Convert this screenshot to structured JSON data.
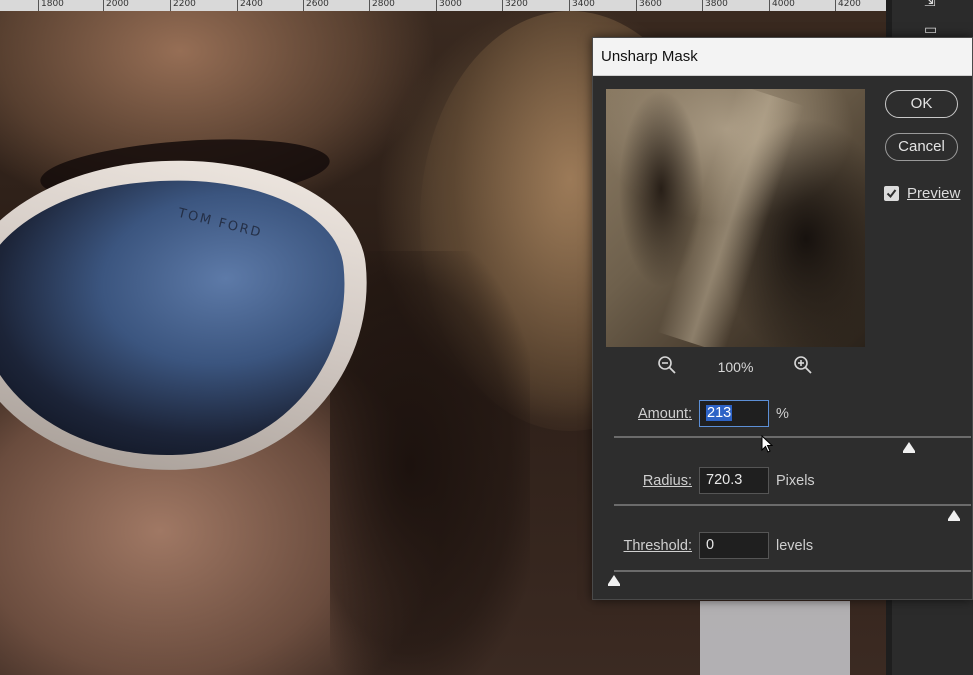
{
  "ruler": {
    "ticks": [
      "1800",
      "2000",
      "2200",
      "2400",
      "2600",
      "2800",
      "3000",
      "3200",
      "3400",
      "3600",
      "3800",
      "4000",
      "4200"
    ]
  },
  "canvas": {
    "brand_text": "TOM FORD"
  },
  "dialog": {
    "title": "Unsharp Mask",
    "zoom": {
      "percent": "100%",
      "zoom_out_icon": "zoom-out-icon",
      "zoom_in_icon": "zoom-in-icon"
    },
    "buttons": {
      "ok": "OK",
      "cancel": "Cancel"
    },
    "preview": {
      "label": "Preview",
      "checked": true
    },
    "amount": {
      "label": "Amount:",
      "value": "213",
      "unit": "%",
      "level": 0.86
    },
    "radius": {
      "label": "Radius:",
      "value": "720.3",
      "unit": "Pixels",
      "level": 0.99
    },
    "threshold": {
      "label": "Threshold:",
      "value": "0",
      "unit": "levels",
      "level": 0.0
    }
  },
  "colors": {
    "dialog_bg": "#2d2d2d",
    "title_bg": "#f3f3f3",
    "selection": "#2d63c6"
  }
}
